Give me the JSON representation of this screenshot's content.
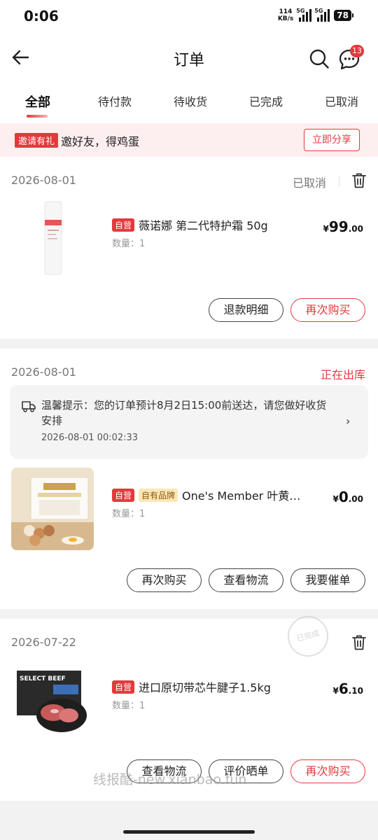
{
  "status_bar": {
    "time": "0:06",
    "speed_value": "114",
    "speed_unit": "KB/s",
    "net1": "5G",
    "net2": "5G",
    "battery": "78"
  },
  "header": {
    "title": "订单",
    "message_badge": "13"
  },
  "tabs": [
    {
      "label": "全部",
      "active": true
    },
    {
      "label": "待付款"
    },
    {
      "label": "待收货"
    },
    {
      "label": "已完成"
    },
    {
      "label": "已取消"
    }
  ],
  "invite_banner": {
    "tag": "邀请有礼",
    "text": "邀好友，得鸡蛋",
    "button": "立即分享"
  },
  "orders": [
    {
      "date": "2026-08-01",
      "status": "已取消",
      "product": {
        "tag": "自营",
        "name": "薇诺娜 第二代特护霜 50g",
        "qty": "数量：1",
        "price_symbol": "¥",
        "price_int": "99",
        "price_dec": ".00"
      },
      "buttons": [
        "退款明细",
        "再次购买"
      ]
    },
    {
      "date": "2026-08-01",
      "status": "正在出库",
      "notice": {
        "text": "温馨提示：您的订单预计8月2日15:00前送达，请您做好收货安排",
        "time": "2026-08-01 00:02:33"
      },
      "product": {
        "tag": "自营",
        "brand_tag": "自有品牌",
        "name": "One's Member 叶黄…",
        "qty": "数量：1",
        "price_symbol": "¥",
        "price_int": "0",
        "price_dec": ".00"
      },
      "buttons": [
        "再次购买",
        "查看物流",
        "我要催单"
      ]
    },
    {
      "date": "2026-07-22",
      "stamp": "已完成",
      "product": {
        "tag": "自营",
        "name": "进口原切带芯牛腱子1.5kg",
        "qty": "数量：1",
        "price_symbol": "¥",
        "price_int": "6",
        "price_dec": ".10",
        "image_text": "SELECT BEEF"
      },
      "buttons": [
        "查看物流",
        "评价晒单",
        "再次购买"
      ]
    }
  ],
  "watermark": "线报酷-new.xianbao.fun",
  "colors": {
    "accent": "#e4393c",
    "background": "#f2f2f2",
    "invite_bg": "#fdeeef"
  }
}
